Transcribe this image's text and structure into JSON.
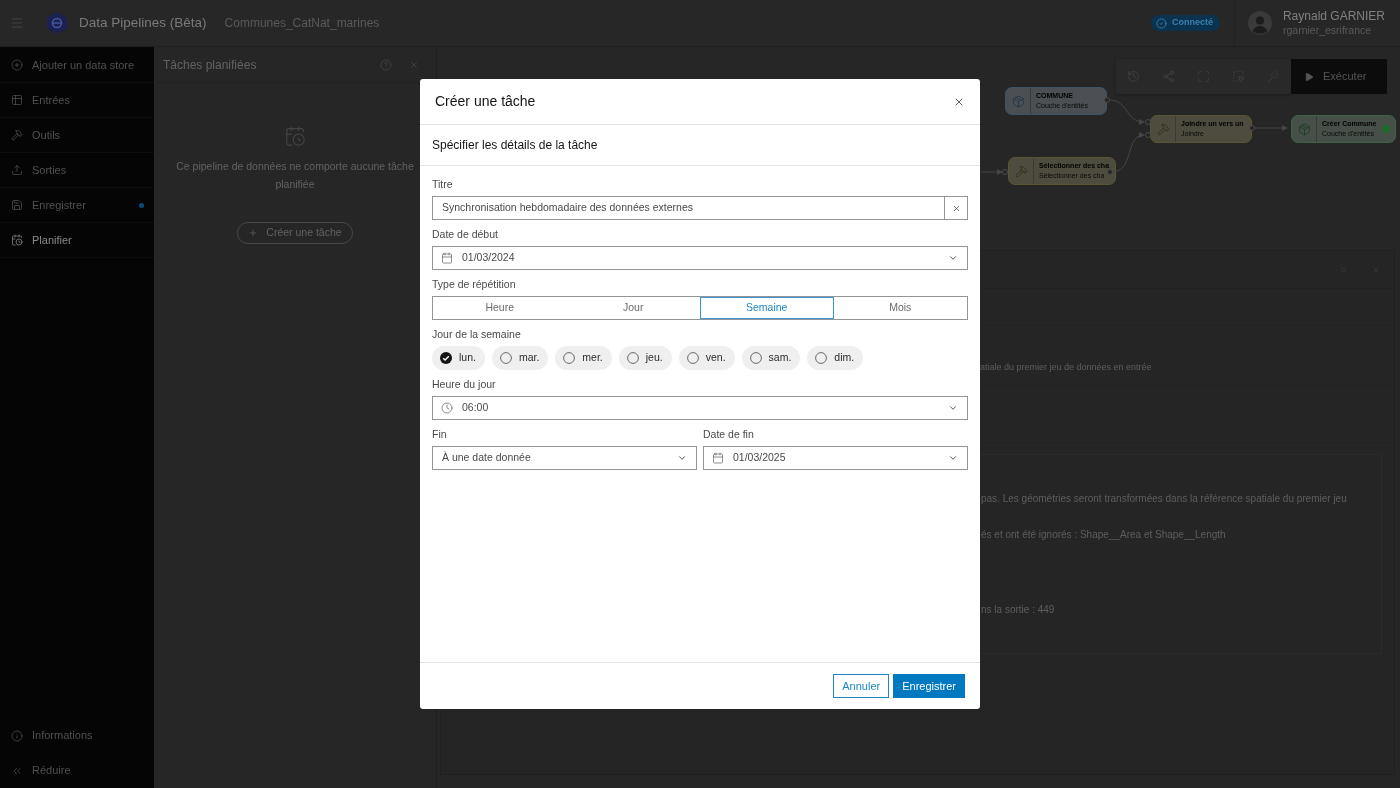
{
  "header": {
    "app_title": "Data Pipelines (Bêta)",
    "pipeline_name": "Communes_CatNat_marines",
    "status_badge": "Connecté",
    "user": {
      "name": "Raynald GARNIER",
      "username": "rgarnier_esrifrance"
    }
  },
  "sidebar": {
    "items": [
      {
        "label": "Ajouter un data store",
        "selected": false,
        "indicator": false
      },
      {
        "label": "Entrées",
        "selected": false,
        "indicator": false
      },
      {
        "label": "Outils",
        "selected": false,
        "indicator": false
      },
      {
        "label": "Sorties",
        "selected": false,
        "indicator": false
      },
      {
        "label": "Enregistrer",
        "selected": false,
        "indicator": true
      },
      {
        "label": "Planifier",
        "selected": true,
        "indicator": false
      }
    ],
    "footer_items": [
      {
        "label": "Informations"
      },
      {
        "label": "Réduire"
      }
    ]
  },
  "scheduled_tasks_panel": {
    "title": "Tâches planifiées",
    "empty_message": "Ce pipeline de données ne comporte aucune tâche planifiée",
    "create_button": "Créer une tâche"
  },
  "canvas": {
    "run_button": "Exécuter",
    "nodes": [
      {
        "kind": "input",
        "title": "COMMUNE",
        "subtitle": "Couche d'entités",
        "ready": false
      },
      {
        "kind": "tool",
        "title": "Joindre un vers un",
        "subtitle": "Joindre",
        "ready": false
      },
      {
        "kind": "output",
        "title": "Créer Commune",
        "subtitle": "Couche d'entités",
        "ready": true
      },
      {
        "kind": "tool",
        "title": "Sélectionner des cha",
        "subtitle": "Sélectionner des cha",
        "ready": false
      }
    ]
  },
  "results_panel": {
    "summary": "atiale du premier jeu de données en entrée",
    "messages": [
      "pas. Les géométries seront transformées dans la référence spatiale du premier jeu",
      "és et ont été ignorés : Shape__Area et Shape__Length",
      "ns la sortie : 449"
    ]
  },
  "dialog": {
    "title": "Créer une tâche",
    "subtitle": "Spécifier les détails de la tâche",
    "title_field": {
      "label": "Titre",
      "value": "Synchronisation hebdomadaire des données externes"
    },
    "start_date": {
      "label": "Date de début",
      "value": "01/03/2024"
    },
    "repeat_type": {
      "label": "Type de répétition",
      "options": [
        {
          "label": "Heure",
          "selected": false
        },
        {
          "label": "Jour",
          "selected": false
        },
        {
          "label": "Semaine",
          "selected": true
        },
        {
          "label": "Mois",
          "selected": false
        }
      ]
    },
    "weekdays": {
      "label": "Jour de la semaine",
      "days": [
        {
          "label": "lun.",
          "checked": true
        },
        {
          "label": "mar.",
          "checked": false
        },
        {
          "label": "mer.",
          "checked": false
        },
        {
          "label": "jeu.",
          "checked": false
        },
        {
          "label": "ven.",
          "checked": false
        },
        {
          "label": "sam.",
          "checked": false
        },
        {
          "label": "dim.",
          "checked": false
        }
      ]
    },
    "time_of_day": {
      "label": "Heure du jour",
      "value": "06:00"
    },
    "end": {
      "label": "Fin",
      "value": "À une date donnée"
    },
    "end_date": {
      "label": "Date de fin",
      "value": "01/03/2025"
    },
    "buttons": [
      {
        "label": "Annuler",
        "kind": "secondary"
      },
      {
        "label": "Enregistrer",
        "kind": "primary"
      }
    ]
  }
}
